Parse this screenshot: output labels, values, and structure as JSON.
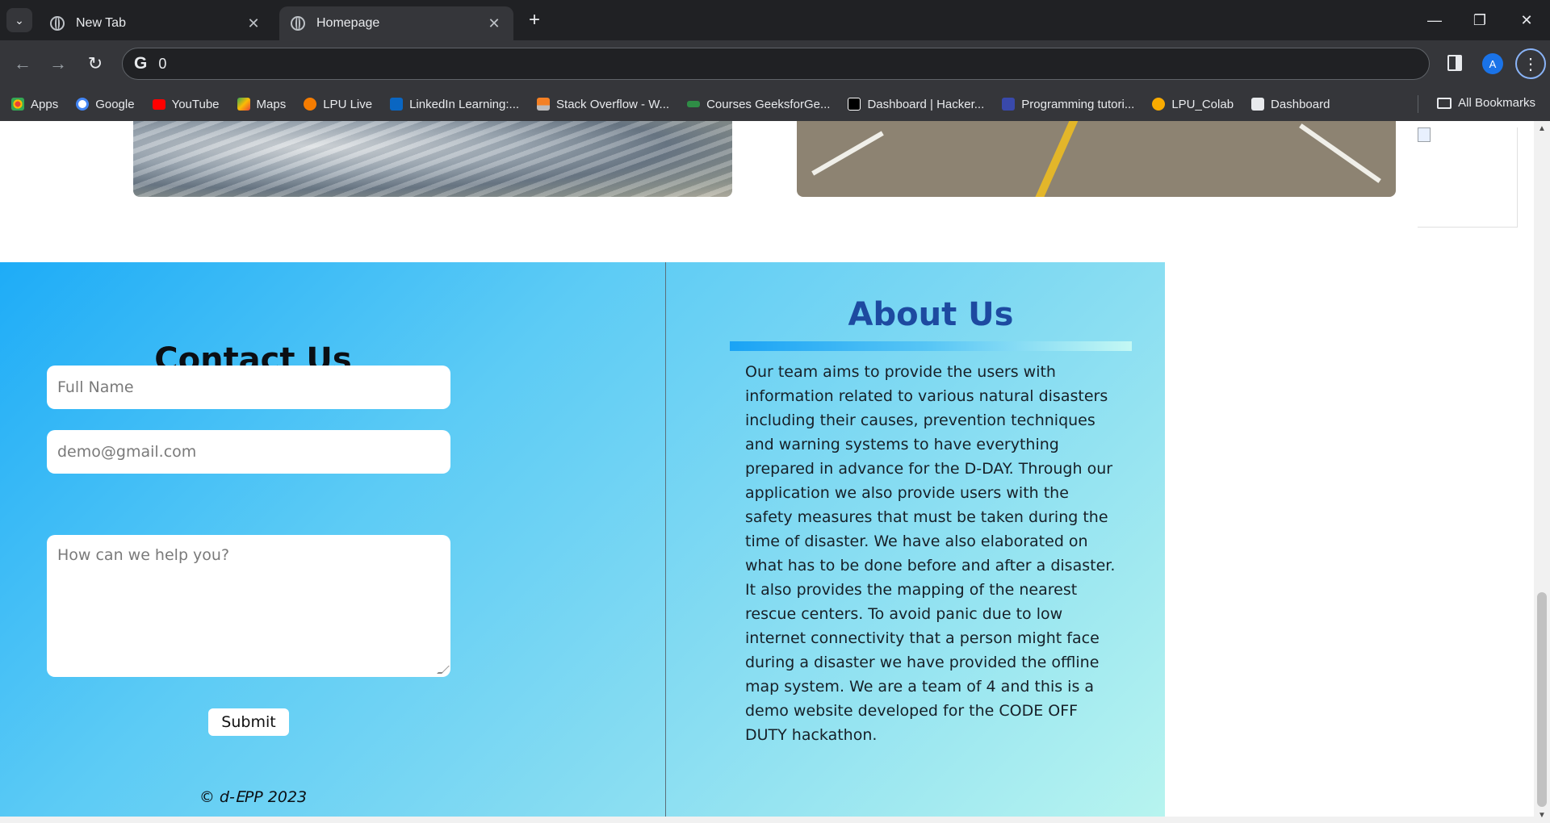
{
  "browser": {
    "tabs": [
      {
        "title": "New Tab",
        "active": false
      },
      {
        "title": "Homepage",
        "active": true
      }
    ],
    "address": "0",
    "profile_initial": "A",
    "bookmarks": [
      {
        "label": "Apps",
        "icon": "apps-grid-icon",
        "color": "#ea4335"
      },
      {
        "label": "Google",
        "icon": "google-icon",
        "color": "#4285f4"
      },
      {
        "label": "YouTube",
        "icon": "youtube-icon",
        "color": "#ff0000"
      },
      {
        "label": "Maps",
        "icon": "maps-icon",
        "color": "#34a853"
      },
      {
        "label": "LPU Live",
        "icon": "lpu-live-icon",
        "color": "#f57c00"
      },
      {
        "label": "LinkedIn Learning:...",
        "icon": "linkedin-learning-icon",
        "color": "#0a66c2"
      },
      {
        "label": "Stack Overflow - W...",
        "icon": "stack-overflow-icon",
        "color": "#f48024"
      },
      {
        "label": "Courses GeeksforGe...",
        "icon": "geeksforgeeks-icon",
        "color": "#2f8d46"
      },
      {
        "label": "Dashboard | Hacker...",
        "icon": "hackerrank-icon",
        "color": "#000000"
      },
      {
        "label": "Programming tutori...",
        "icon": "programming-icon",
        "color": "#3949ab"
      },
      {
        "label": "LPU_Colab",
        "icon": "colab-icon",
        "color": "#f9ab00"
      },
      {
        "label": "Dashboard",
        "icon": "cc-icon",
        "color": "#888888"
      }
    ],
    "all_bookmarks": "All Bookmarks"
  },
  "contact": {
    "title": "Contact Us",
    "name_placeholder": "Full Name",
    "email_placeholder": "demo@gmail.com",
    "message_placeholder": "How can we help you?",
    "submit": "Submit",
    "copyright": "© d-𝖤PP 2023"
  },
  "about": {
    "title": "About Us",
    "text": "Our team aims to provide the users with information related to various natural disasters including their causes, prevention techniques and warning systems to have everything prepared in advance for the D-DAY. Through our application we also provide users with the safety measures that must be taken during the time of disaster. We have also elaborated on what has to be done before and after a disaster. It also provides the mapping of the nearest rescue centers. To avoid panic due to low internet connectivity that a person might face during a disaster we have provided the offline map system. We are a team of 4 and this is a demo website developed for the CODE OFF DUTY hackathon."
  },
  "colors": {
    "accent": "#1d4aa0",
    "gradient_start": "#1eacf7",
    "gradient_end": "#b7f4ef"
  }
}
